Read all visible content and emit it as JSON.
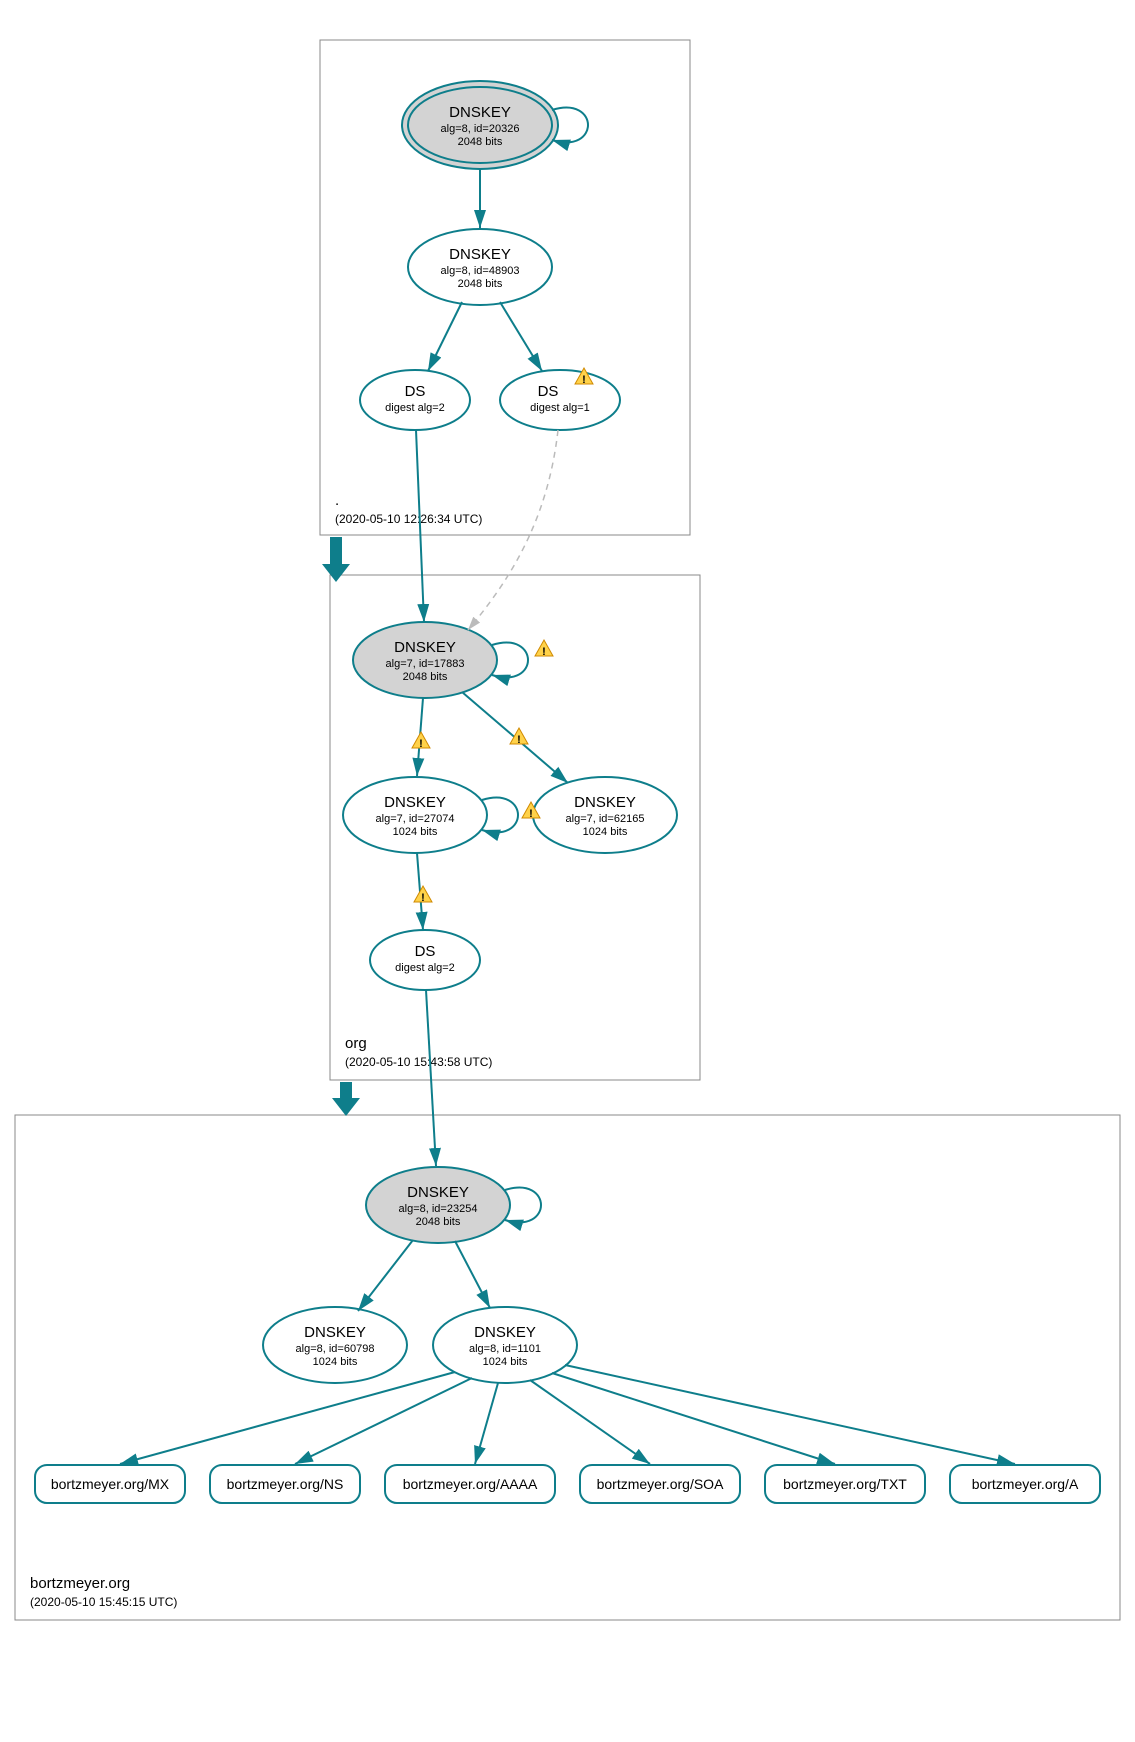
{
  "chart_data": {
    "type": "graph",
    "zones": [
      {
        "name": ".",
        "ts": "(2020-05-10 12:26:34 UTC)"
      },
      {
        "name": "org",
        "ts": "(2020-05-10 15:43:58 UTC)"
      },
      {
        "name": "bortzmeyer.org",
        "ts": "(2020-05-10 15:45:15 UTC)"
      }
    ],
    "nodes": [
      {
        "id": "k1",
        "title": "DNSKEY",
        "sub1": "alg=8, id=20326",
        "sub2": "2048 bits",
        "kind": "ksk",
        "zone": 0
      },
      {
        "id": "k2",
        "title": "DNSKEY",
        "sub1": "alg=8, id=48903",
        "sub2": "2048 bits",
        "kind": "zsk",
        "zone": 0
      },
      {
        "id": "ds1",
        "title": "DS",
        "sub1": "digest alg=2",
        "kind": "ds",
        "zone": 0
      },
      {
        "id": "ds2",
        "title": "DS",
        "sub1": "digest alg=1",
        "kind": "ds",
        "zone": 0,
        "warn": true
      },
      {
        "id": "k3",
        "title": "DNSKEY",
        "sub1": "alg=7, id=17883",
        "sub2": "2048 bits",
        "kind": "ksk",
        "zone": 1,
        "selfwarn": true
      },
      {
        "id": "k4",
        "title": "DNSKEY",
        "sub1": "alg=7, id=27074",
        "sub2": "1024 bits",
        "kind": "zsk",
        "zone": 1,
        "selfwarn": true
      },
      {
        "id": "k5",
        "title": "DNSKEY",
        "sub1": "alg=7, id=62165",
        "sub2": "1024 bits",
        "kind": "zsk",
        "zone": 1
      },
      {
        "id": "ds3",
        "title": "DS",
        "sub1": "digest alg=2",
        "kind": "ds",
        "zone": 1
      },
      {
        "id": "k6",
        "title": "DNSKEY",
        "sub1": "alg=8, id=23254",
        "sub2": "2048 bits",
        "kind": "ksk",
        "zone": 2
      },
      {
        "id": "k7",
        "title": "DNSKEY",
        "sub1": "alg=8, id=60798",
        "sub2": "1024 bits",
        "kind": "zsk",
        "zone": 2
      },
      {
        "id": "k8",
        "title": "DNSKEY",
        "sub1": "alg=8, id=1101",
        "sub2": "1024 bits",
        "kind": "zsk",
        "zone": 2
      },
      {
        "id": "r1",
        "label": "bortzmeyer.org/MX",
        "kind": "rr",
        "zone": 2
      },
      {
        "id": "r2",
        "label": "bortzmeyer.org/NS",
        "kind": "rr",
        "zone": 2
      },
      {
        "id": "r3",
        "label": "bortzmeyer.org/AAAA",
        "kind": "rr",
        "zone": 2
      },
      {
        "id": "r4",
        "label": "bortzmeyer.org/SOA",
        "kind": "rr",
        "zone": 2
      },
      {
        "id": "r5",
        "label": "bortzmeyer.org/TXT",
        "kind": "rr",
        "zone": 2
      },
      {
        "id": "r6",
        "label": "bortzmeyer.org/A",
        "kind": "rr",
        "zone": 2
      }
    ],
    "edges": [
      {
        "from": "k1",
        "to": "k1",
        "self": true
      },
      {
        "from": "k1",
        "to": "k2"
      },
      {
        "from": "k2",
        "to": "ds1"
      },
      {
        "from": "k2",
        "to": "ds2"
      },
      {
        "from": "ds1",
        "to": "k3"
      },
      {
        "from": "ds2",
        "to": "k3",
        "dashed": true
      },
      {
        "from": "k3",
        "to": "k3",
        "self": true,
        "warn": true
      },
      {
        "from": "k3",
        "to": "k4",
        "warn": true
      },
      {
        "from": "k3",
        "to": "k5",
        "warn": true
      },
      {
        "from": "k4",
        "to": "k4",
        "self": true,
        "warn": true
      },
      {
        "from": "k4",
        "to": "ds3",
        "warn": true
      },
      {
        "from": "ds3",
        "to": "k6"
      },
      {
        "from": "k6",
        "to": "k6",
        "self": true
      },
      {
        "from": "k6",
        "to": "k7"
      },
      {
        "from": "k6",
        "to": "k8"
      },
      {
        "from": "k8",
        "to": "r1"
      },
      {
        "from": "k8",
        "to": "r2"
      },
      {
        "from": "k8",
        "to": "r3"
      },
      {
        "from": "k8",
        "to": "r4"
      },
      {
        "from": "k8",
        "to": "r5"
      },
      {
        "from": "k8",
        "to": "r6"
      }
    ]
  },
  "zones": {
    "z0": {
      "name": ".",
      "ts": "(2020-05-10 12:26:34 UTC)"
    },
    "z1": {
      "name": "org",
      "ts": "(2020-05-10 15:43:58 UTC)"
    },
    "z2": {
      "name": "bortzmeyer.org",
      "ts": "(2020-05-10 15:45:15 UTC)"
    }
  },
  "n": {
    "k1": {
      "t": "DNSKEY",
      "s1": "alg=8, id=20326",
      "s2": "2048 bits"
    },
    "k2": {
      "t": "DNSKEY",
      "s1": "alg=8, id=48903",
      "s2": "2048 bits"
    },
    "ds1": {
      "t": "DS",
      "s1": "digest alg=2"
    },
    "ds2": {
      "t": "DS",
      "s1": "digest alg=1"
    },
    "k3": {
      "t": "DNSKEY",
      "s1": "alg=7, id=17883",
      "s2": "2048 bits"
    },
    "k4": {
      "t": "DNSKEY",
      "s1": "alg=7, id=27074",
      "s2": "1024 bits"
    },
    "k5": {
      "t": "DNSKEY",
      "s1": "alg=7, id=62165",
      "s2": "1024 bits"
    },
    "ds3": {
      "t": "DS",
      "s1": "digest alg=2"
    },
    "k6": {
      "t": "DNSKEY",
      "s1": "alg=8, id=23254",
      "s2": "2048 bits"
    },
    "k7": {
      "t": "DNSKEY",
      "s1": "alg=8, id=60798",
      "s2": "1024 bits"
    },
    "k8": {
      "t": "DNSKEY",
      "s1": "alg=8, id=1101",
      "s2": "1024 bits"
    },
    "r1": {
      "l": "bortzmeyer.org/MX"
    },
    "r2": {
      "l": "bortzmeyer.org/NS"
    },
    "r3": {
      "l": "bortzmeyer.org/AAAA"
    },
    "r4": {
      "l": "bortzmeyer.org/SOA"
    },
    "r5": {
      "l": "bortzmeyer.org/TXT"
    },
    "r6": {
      "l": "bortzmeyer.org/A"
    }
  }
}
